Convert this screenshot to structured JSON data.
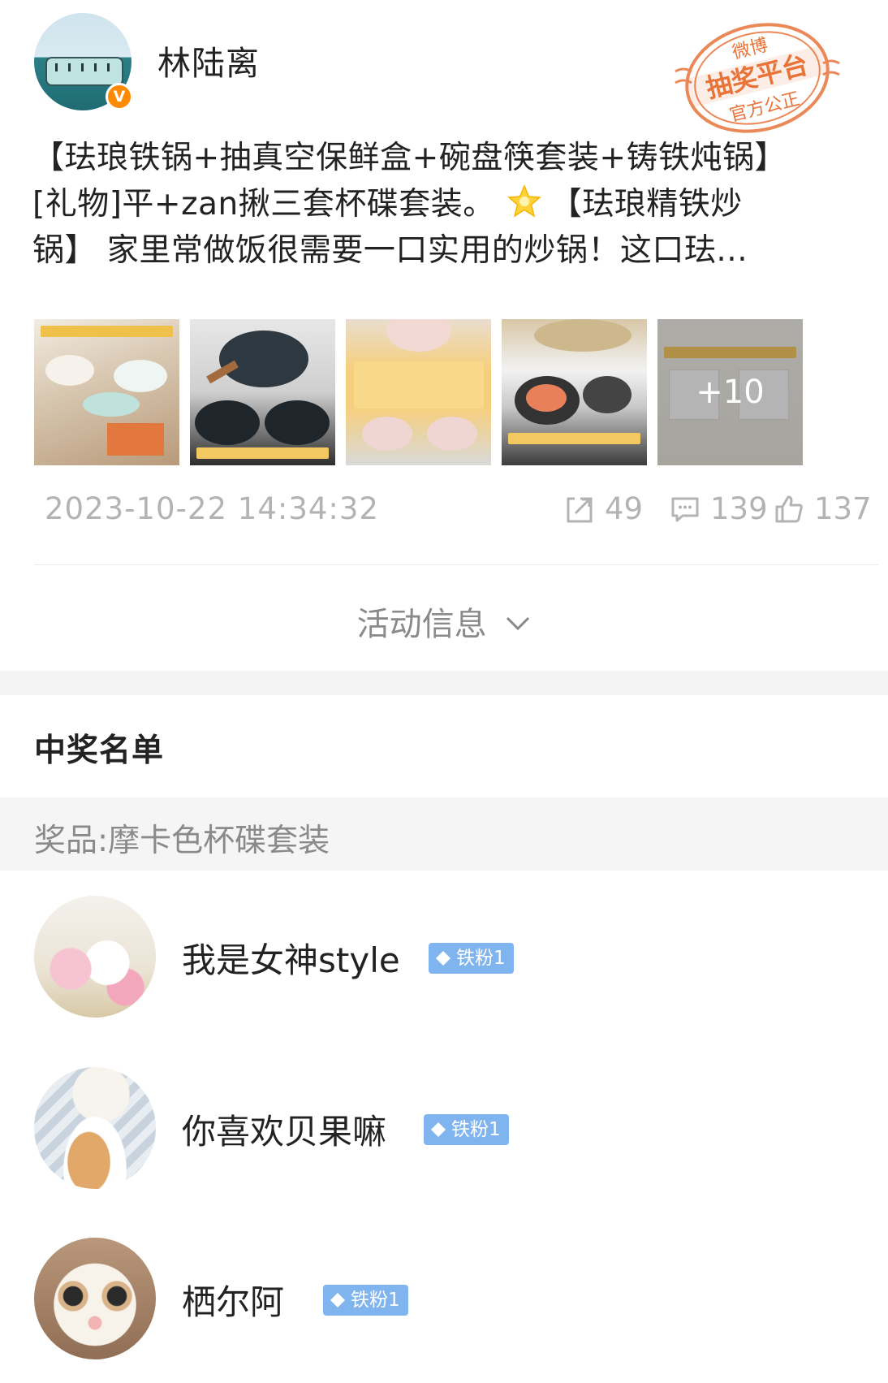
{
  "post": {
    "author": {
      "name": "林陆离",
      "verified_icon": "V"
    },
    "stamp": {
      "top": "微博",
      "middle": "抽奖平台",
      "bottom": "官方公正"
    },
    "text_lines": [
      "【珐琅铁锅+抽真空保鲜盒+碗盘筷套装+铸铁炖锅】",
      "[礼物]平+zan揪三套杯碟套装。",
      "【珐琅精铁炒",
      "锅】 家里常做饭很需要一口实用的炒锅！这口珐..."
    ],
    "images": {
      "count": 5,
      "more_label": "+10"
    },
    "timestamp": "2023-10-22 14:34:32",
    "stats": {
      "reposts": "49",
      "comments": "139",
      "likes": "137"
    },
    "icons": {
      "repost": "share-icon",
      "comment": "comment-icon",
      "like": "thumbs-up-icon",
      "star": "star-emoji-icon"
    }
  },
  "activity": {
    "label": "活动信息"
  },
  "winners": {
    "title": "中奖名单",
    "prize": "奖品:摩卡色杯碟套装",
    "list": [
      {
        "name": "我是女神style",
        "badge": "铁粉1"
      },
      {
        "name": "你喜欢贝果嘛",
        "badge": "铁粉1"
      },
      {
        "name": "栖尔阿",
        "badge": "铁粉1"
      }
    ]
  },
  "colors": {
    "badge_blue": "#7fb4ef",
    "verified_orange": "#ff8a00",
    "stamp_orange": "#e8743a",
    "meta_gray": "#b3b3b3"
  }
}
